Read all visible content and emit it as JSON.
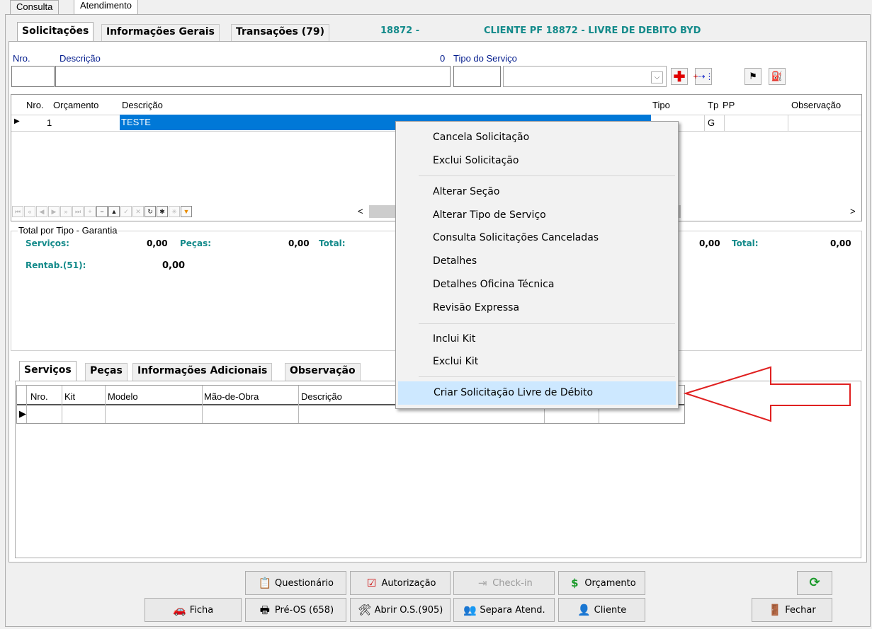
{
  "top_tabs": [
    "Consulta",
    "Atendimento"
  ],
  "subtabs": [
    "Solicitações",
    "Informações Gerais",
    "Transações (79)"
  ],
  "header": {
    "code": "18872 -",
    "client": "CLIENTE PF 18872 - LIVRE DE DEBITO BYD"
  },
  "form": {
    "nro_label": "Nro.",
    "descricao_label": "Descrição",
    "zero": "0",
    "tipo_servico_label": "Tipo do Serviço"
  },
  "grid": {
    "columns": [
      "Nro.",
      "Orçamento",
      "Descrição",
      "Tipo",
      "Tp",
      "PP",
      "Observação"
    ],
    "rows": [
      {
        "nro": "1",
        "orcamento": "",
        "descricao": "TESTE",
        "tipo": "",
        "tp": "G",
        "pp": "",
        "obs": ""
      }
    ]
  },
  "totals": {
    "title": "Total por Tipo - Garantia",
    "servicos_label": "Serviços:",
    "servicos_val": "0,00",
    "pecas_label": "Peças:",
    "pecas_val": "0,00",
    "total_label": "Total:",
    "right_val": "0,00",
    "right_total_label": "Total:",
    "right_total_val": "0,00",
    "rentab_label": "Rentab.(51):",
    "rentab_val": "0,00"
  },
  "bottom_tabs": [
    "Serviços",
    "Peças",
    "Informações Adicionais",
    "Observação"
  ],
  "services_grid": {
    "columns": [
      "Nro.",
      "Kit",
      "Modelo",
      "Mão-de-Obra",
      "Descrição"
    ]
  },
  "context_menu": [
    {
      "label": "Cancela Solicitação"
    },
    {
      "label": "Exclui Solicitação"
    },
    {
      "label": "Alterar Seção"
    },
    {
      "label": "Alterar Tipo de Serviço"
    },
    {
      "label": "Consulta Solicitações Canceladas"
    },
    {
      "label": "Detalhes"
    },
    {
      "label": "Detalhes Oficina Técnica"
    },
    {
      "label": "Revisão Expressa"
    },
    {
      "label": "Inclui Kit"
    },
    {
      "label": "Exclui Kit"
    },
    {
      "label": "Criar Solicitação Livre de Débito"
    }
  ],
  "buttons": {
    "questionario": "Questionário",
    "autorizacao": "Autorização",
    "checkin": "Check-in",
    "orcamento": "Orçamento",
    "ficha": "Ficha",
    "pre_os": "Pré-OS (658)",
    "abrir_os": "Abrir O.S.(905)",
    "separa": "Separa Atend.",
    "cliente": "Cliente",
    "fechar": "Fechar"
  },
  "colors": {
    "teal": "#138a8a",
    "selection": "#0078d7",
    "arrow": "#e02020",
    "menu_highlight": "#cde8ff"
  }
}
